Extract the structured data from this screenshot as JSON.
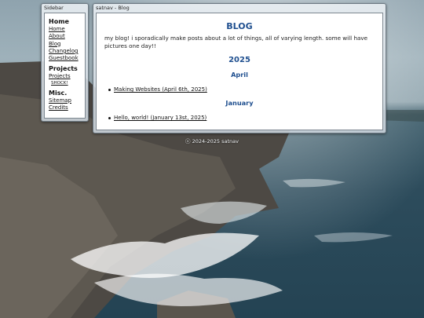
{
  "sidebar": {
    "title": "Sidebar",
    "sections": [
      {
        "heading": "Home",
        "links": [
          "Home",
          "About",
          "Blog",
          "Changelog",
          "Guestbook"
        ]
      },
      {
        "heading": "Projects",
        "links": [
          "Projects"
        ],
        "sublinks": [
          "SHOCK!"
        ]
      },
      {
        "heading": "Misc.",
        "links": [
          "Sitemap",
          "Credits"
        ]
      }
    ]
  },
  "main": {
    "title": "satnav - Blog",
    "heading": "BLOG",
    "intro": "my blog! i sporadically make posts about a lot of things, all of varying length. some will have pictures one day!!",
    "years": [
      {
        "year": "2025",
        "months": [
          {
            "month": "April",
            "posts": [
              "Making Websites (April 6th, 2025)"
            ]
          },
          {
            "month": "January",
            "posts": [
              "Hello, world! (January 13st, 2025)"
            ]
          }
        ]
      }
    ]
  },
  "footer": {
    "text": "ⓢ 2024-2025 satnav"
  },
  "colors": {
    "accent": "#1f4f8f",
    "sea": "#2d4c5c",
    "sky": "#9eb1ba",
    "rock": "#4a4640"
  }
}
